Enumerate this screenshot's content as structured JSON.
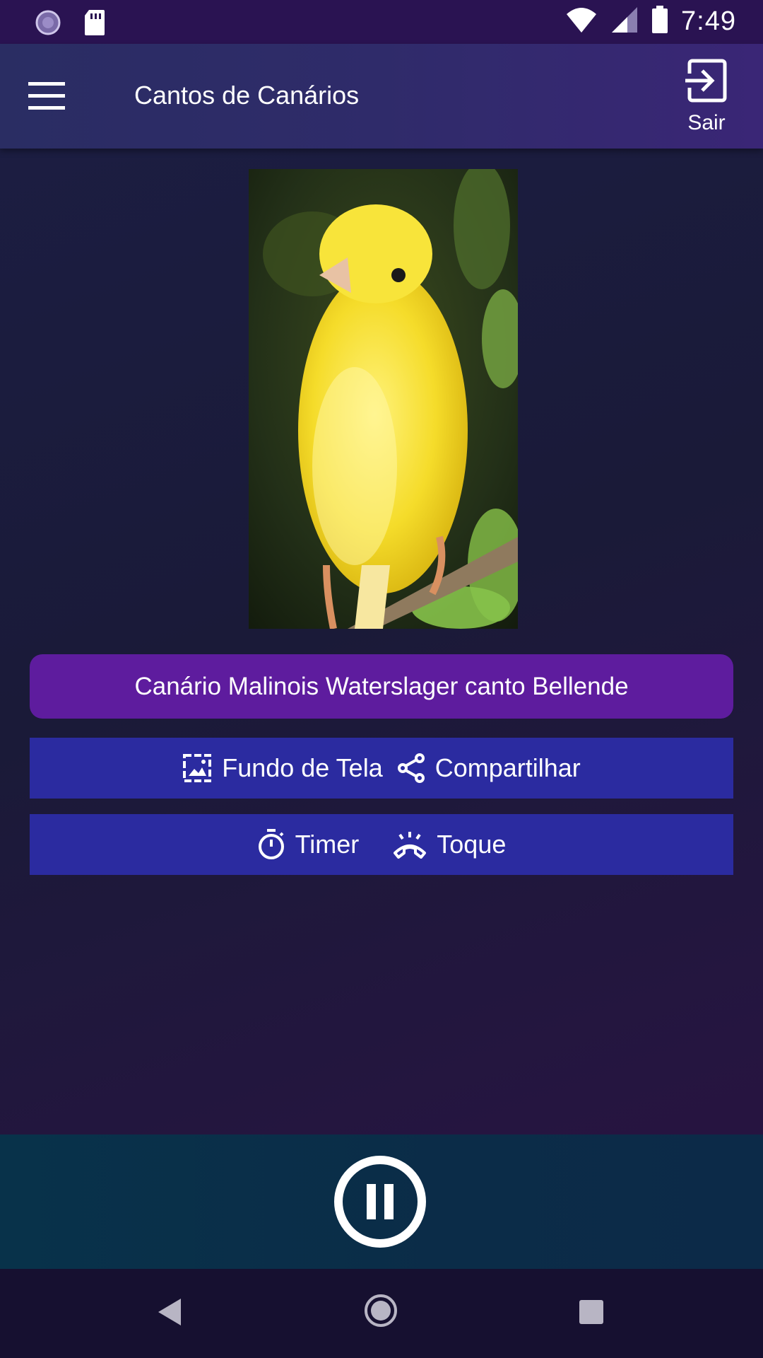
{
  "status_bar": {
    "time": "7:49",
    "icons": [
      "sync-icon",
      "sd-card-icon",
      "wifi-icon",
      "signal-icon",
      "battery-icon"
    ]
  },
  "app_bar": {
    "title": "Cantos de Canários",
    "exit_label": "Sair"
  },
  "song": {
    "title": "Canário Malinois Waterslager canto Bellende"
  },
  "actions": {
    "wallpaper_label": "Fundo de Tela",
    "share_label": "Compartilhar",
    "timer_label": "Timer",
    "ringtone_label": "Toque"
  },
  "player": {
    "state": "playing"
  },
  "colors": {
    "status_bar": "#2a1352",
    "app_bar": "#2f2b6a",
    "title_pill": "#5e1c9e",
    "action_row": "#2b2ba0",
    "player_bar": "#0b2c48"
  }
}
